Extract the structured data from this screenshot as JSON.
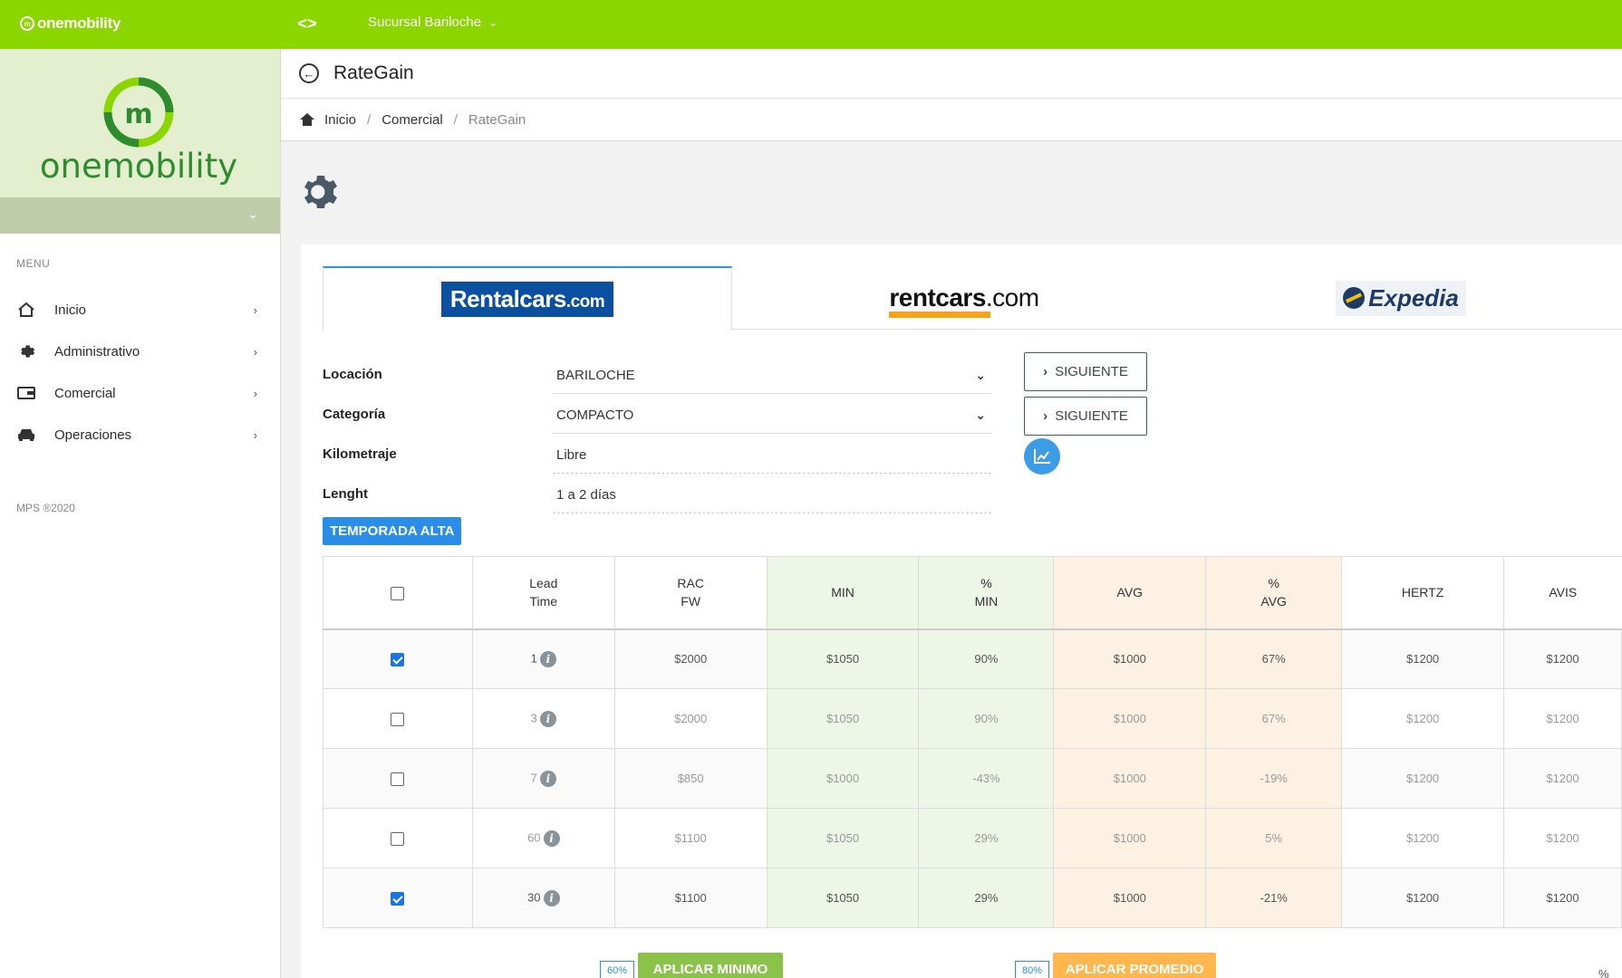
{
  "topbar": {
    "logo_text": "onemobility",
    "branch": "Sucursal Bariloche"
  },
  "sidebar": {
    "brand_name": "onemobility",
    "menu_title": "MENU",
    "items": [
      {
        "label": "Inicio",
        "icon": "home-icon"
      },
      {
        "label": "Administrativo",
        "icon": "gear-icon"
      },
      {
        "label": "Comercial",
        "icon": "wallet-icon"
      },
      {
        "label": "Operaciones",
        "icon": "car-icon"
      }
    ],
    "footer": "MPS ®2020"
  },
  "header": {
    "title": "RateGain"
  },
  "breadcrumb": [
    "Inicio",
    "Comercial",
    "RateGain"
  ],
  "tabs": [
    {
      "name": "Rentalcars.com",
      "part1": "Rentalcars",
      "part2": ".com",
      "active": true
    },
    {
      "name": "rentcars.com",
      "part1": "rentcars",
      "part2": ".com",
      "active": false
    },
    {
      "name": "Expedia",
      "part1": "Expedia",
      "active": false
    }
  ],
  "form": {
    "location": {
      "label": "Locación",
      "value": "BARILOCHE"
    },
    "category": {
      "label": "Categoría",
      "value": "COMPACTO"
    },
    "mileage": {
      "label": "Kilometraje",
      "value": "Libre"
    },
    "length": {
      "label": "Lenght",
      "value": "1 a 2 días"
    },
    "next_label": "SIGUIENTE",
    "season_badge": "TEMPORADA ALTA"
  },
  "table": {
    "headers": {
      "lead_time_1": "Lead",
      "lead_time_2": "Time",
      "rac_1": "RAC",
      "rac_2": "FW",
      "min": "MIN",
      "pct_min_1": "%",
      "pct_min_2": "MIN",
      "avg": "AVG",
      "pct_avg_1": "%",
      "pct_avg_2": "AVG",
      "hertz": "HERTZ",
      "avis": "AVIS"
    },
    "rows": [
      {
        "checked": true,
        "lead": "1",
        "rac": "$2000",
        "min": "$1050",
        "pct_min": "90%",
        "avg": "$1000",
        "pct_avg": "67%",
        "hertz": "$1200",
        "avis": "$1200",
        "muted": false
      },
      {
        "checked": false,
        "lead": "3",
        "rac": "$2000",
        "min": "$1050",
        "pct_min": "90%",
        "avg": "$1000",
        "pct_avg": "67%",
        "hertz": "$1200",
        "avis": "$1200",
        "muted": true
      },
      {
        "checked": false,
        "lead": "7",
        "rac": "$850",
        "min": "$1000",
        "pct_min": "-43%",
        "avg": "$1000",
        "pct_avg": "-19%",
        "hertz": "$1200",
        "avis": "$1200",
        "muted": true
      },
      {
        "checked": false,
        "lead": "60",
        "rac": "$1100",
        "min": "$1050",
        "pct_min": "29%",
        "avg": "$1000",
        "pct_avg": "5%",
        "hertz": "$1200",
        "avis": "$1200",
        "muted": true
      },
      {
        "checked": true,
        "lead": "30",
        "rac": "$1100",
        "min": "$1050",
        "pct_min": "29%",
        "avg": "$1000",
        "pct_avg": "-21%",
        "hertz": "$1200",
        "avis": "$1200",
        "muted": false
      }
    ]
  },
  "actions": {
    "min_pct": "60%",
    "min_label": "APLICAR MINIMO",
    "avg_pct": "80%",
    "avg_label": "APLICAR PROMEDIO",
    "trailing": "%"
  },
  "colors": {
    "topbar": "#8cd600",
    "brand_green": "#2e8b2e",
    "accent_blue": "#2a8ee8",
    "min_green": "#8bc34a",
    "avg_orange": "#ffb74d"
  }
}
